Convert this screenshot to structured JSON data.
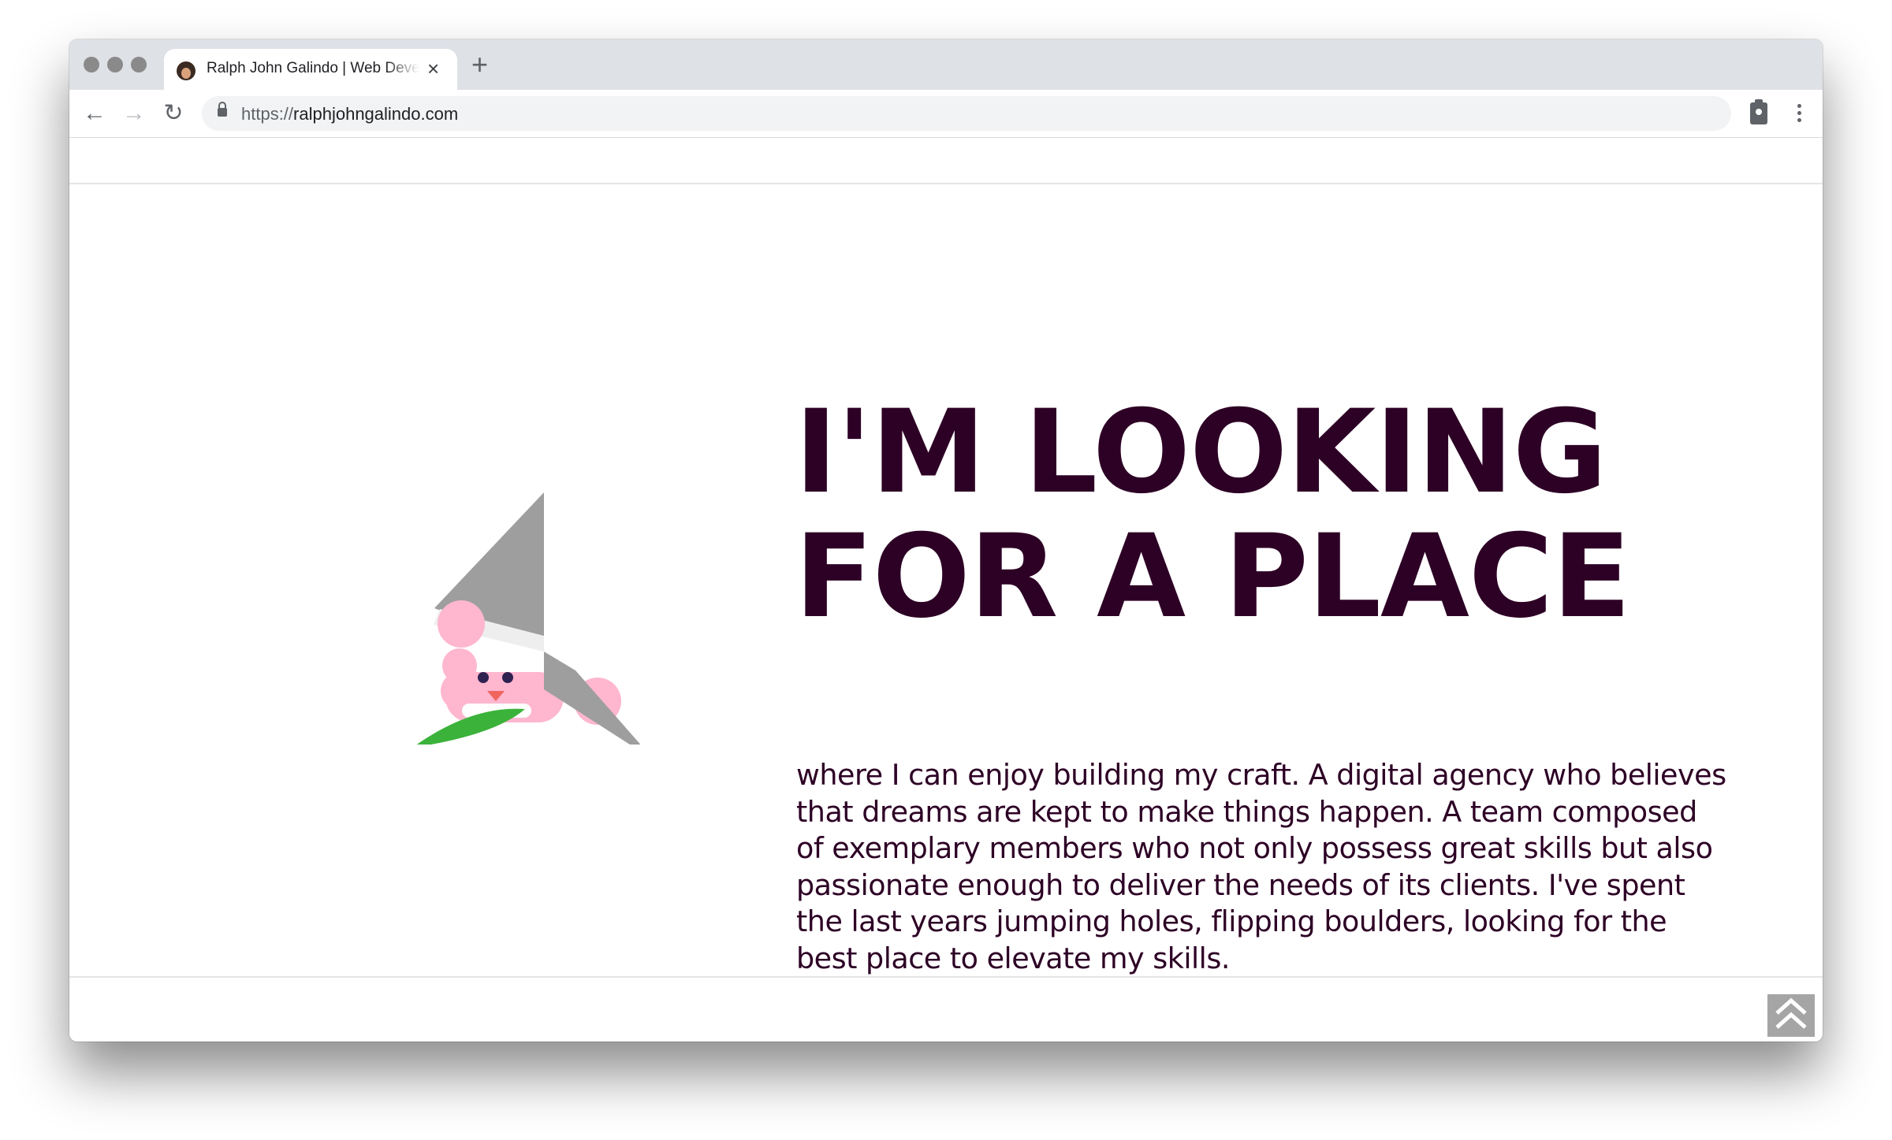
{
  "browser": {
    "tab": {
      "title": "Ralph John Galindo | Web Developer",
      "close_glyph": "×",
      "favicon": "avatar-favicon"
    },
    "new_tab_glyph": "+",
    "nav": {
      "back_glyph": "←",
      "forward_glyph": "→",
      "reload_glyph": "↻"
    },
    "address": {
      "scheme": "https://",
      "host": "ralphjohngalindo.com"
    },
    "icons": [
      "lock-icon",
      "clipboard-extension-icon",
      "kebab-menu-icon"
    ]
  },
  "page": {
    "headline_lines": [
      "I'M LOOKING",
      "FOR A PLACE"
    ],
    "body": "where I can enjoy building my craft. A digital agency who believes that dreams are kept to make things happen. A team composed of exemplary members who not only possess great skills but also passionate enough to deliver the needs of its clients. I've spent the last years jumping holes, flipping boulders, looking for the best place to elevate my skills.",
    "illustration": "pink-creature-with-gray-hat-and-leaf",
    "scroll_top_icon": "double-chevron-up-icon"
  },
  "colors": {
    "text": "#2d0025",
    "hat": "#9e9e9e",
    "hat_band": "#eeeeee",
    "creature": "#ffb6cf",
    "leaf": "#3bb23a",
    "scroll_button": "#a5a5a5"
  }
}
